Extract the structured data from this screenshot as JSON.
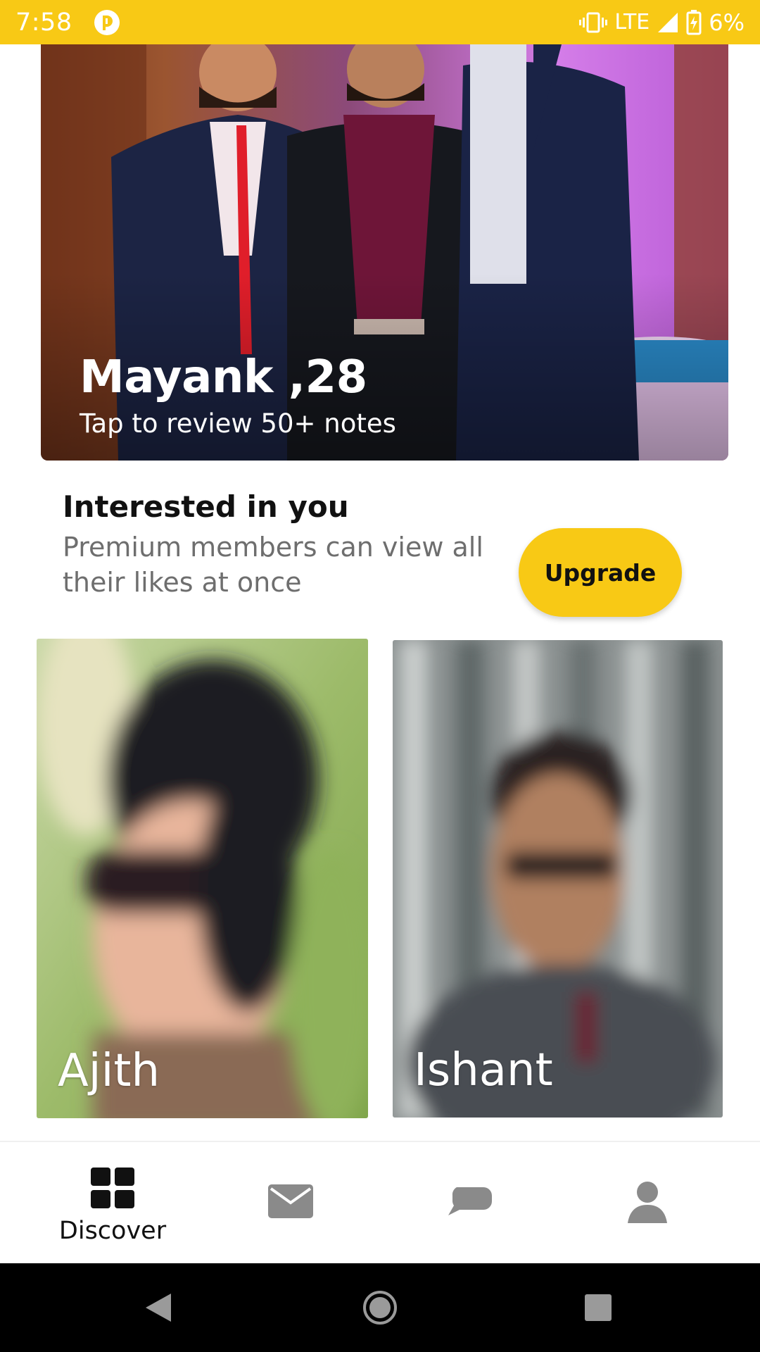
{
  "status_bar": {
    "time": "7:58",
    "network": "LTE",
    "battery": "6%"
  },
  "featured": {
    "name": "Mayank ,28",
    "subtitle": "Tap to review 50+ notes"
  },
  "interested": {
    "title": "Interested in you",
    "description": "Premium members can view all their likes at once",
    "upgrade_label": "Upgrade"
  },
  "likes": [
    {
      "name": "Ajith"
    },
    {
      "name": "Ishant"
    }
  ],
  "bottom_nav": {
    "items": [
      {
        "label": "Discover",
        "icon": "grid-icon",
        "active": true
      },
      {
        "label": "",
        "icon": "mail-icon",
        "active": false
      },
      {
        "label": "",
        "icon": "chat-icon",
        "active": false
      },
      {
        "label": "",
        "icon": "profile-icon",
        "active": false
      }
    ]
  },
  "colors": {
    "accent": "#f8c915",
    "inactive_icon": "#8a8a8a"
  }
}
